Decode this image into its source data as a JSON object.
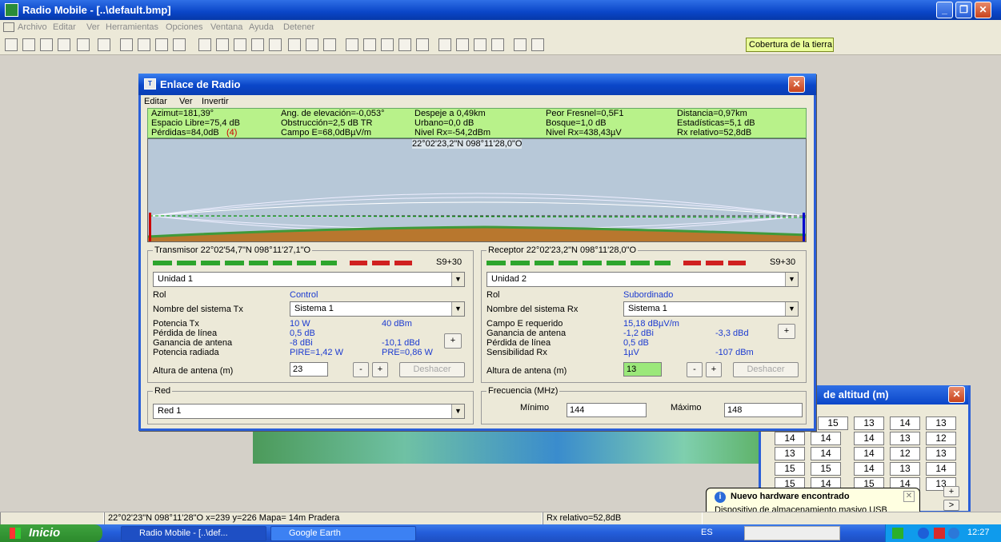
{
  "window": {
    "title": "Radio Mobile - [..\\default.bmp]"
  },
  "menu": [
    "Archivo",
    "Editar",
    "Ver",
    "Herramientas",
    "Opciones",
    "Ventana",
    "Ayuda",
    "Detener"
  ],
  "toolbar": {
    "coverage_label": "Cobertura de la tierra"
  },
  "dialog": {
    "title": "Enlace de Radio",
    "menu": [
      "Editar",
      "Ver",
      "Invertir"
    ],
    "info": {
      "azimut": "Azimut=181,39°",
      "elevacion": "Ang. de elevación=-0,053°",
      "despeje": "Despeje a 0,49km",
      "fresnel": "Peor Fresnel=0,5F1",
      "distancia": "Distancia=0,97km",
      "espacio": "Espacio Libre=75,4 dB",
      "obstruccion": "Obstrucción=2,5 dB TR",
      "urbano": "Urbano=0,0 dB",
      "bosque": "Bosque=1,0 dB",
      "estadisticas": "Estadísticas=5,1 dB",
      "perdidas": "Pérdidas=84,0dB",
      "perdidas_count": "(4)",
      "campo": "Campo E=68,0dBµV/m",
      "nivel_dbm": "Nivel Rx=-54,2dBm",
      "nivel_uv": "Nivel Rx=438,43µV",
      "rx_relativo": "Rx relativo=52,8dB"
    },
    "profile_coord": "22°02'23,2\"N 098°11'28,0\"O",
    "tx": {
      "legend": "Transmisor 22°02'54,7\"N 098°11'27,1\"O",
      "signal": "S9+30",
      "unit": "Unidad  1",
      "rol_label": "Rol",
      "rol": "Control",
      "sistema_label": "Nombre del sistema Tx",
      "sistema": "Sistema  1",
      "potencia_label": "Potencia Tx",
      "potencia_w": "10 W",
      "potencia_dbm": "40 dBm",
      "perdida_label": "Pérdida de línea",
      "perdida": "0,5 dB",
      "ganancia_label": "Ganancia de antena",
      "ganancia_dbi": "-8 dBi",
      "ganancia_dbd": "-10,1 dBd",
      "radiada_label": "Potencia radiada",
      "pire": "PIRE=1,42 W",
      "pre": "PRE=0,86 W",
      "altura_label": "Altura de antena (m)",
      "altura": "23",
      "undo": "Deshacer"
    },
    "rx": {
      "legend": "Receptor 22°02'23,2\"N 098°11'28,0\"O",
      "signal": "S9+30",
      "unit": "Unidad  2",
      "rol_label": "Rol",
      "rol": "Subordinado",
      "sistema_label": "Nombre del sistema Rx",
      "sistema": "Sistema  1",
      "campo_label": "Campo E requerido",
      "campo": "15,18 dBµV/m",
      "ganancia_label": "Ganancia de antena",
      "ganancia_dbi": "-1,2 dBi",
      "ganancia_dbd": "-3,3 dBd",
      "perdida_label": "Pérdida de línea",
      "perdida": "0,5 dB",
      "sens_label": "Sensibilidad Rx",
      "sens_uv": "1µV",
      "sens_dbm": "-107 dBm",
      "altura_label": "Altura de antena (m)",
      "altura": "13",
      "undo": "Deshacer"
    },
    "red": {
      "legend": "Red",
      "value": "Red 1"
    },
    "freq": {
      "legend": "Frecuencia (MHz)",
      "min_label": "Mínimo",
      "min": "144",
      "max_label": "Máximo",
      "max": "148"
    }
  },
  "altitude": {
    "title": "de altitud (m)",
    "rows": [
      [
        "15",
        "13",
        "14",
        "13"
      ],
      [
        "14",
        "14",
        "14",
        "13",
        "12"
      ],
      [
        "13",
        "14",
        "14",
        "12",
        "13"
      ],
      [
        "15",
        "15",
        "14",
        "13",
        "14"
      ],
      [
        "15",
        "14",
        "15",
        "14",
        "13"
      ]
    ]
  },
  "status": {
    "coords": "22°02'23\"N  098°11'28\"O   x=239 y=226 Mapa= 14m Pradera",
    "rx": "Rx relativo=52,8dB"
  },
  "balloon": {
    "title": "Nuevo hardware encontrado",
    "text": "Dispositivo de almacenamiento masivo USB"
  },
  "taskbar": {
    "start": "Inicio",
    "tasks": [
      "Radio Mobile - [..\\def...",
      "Google Earth"
    ],
    "lang": "ES",
    "time": "12:27"
  },
  "colors": {
    "accent": "#0a46c8",
    "info_bg": "#b8f28a",
    "link": "#1b3ad0"
  }
}
